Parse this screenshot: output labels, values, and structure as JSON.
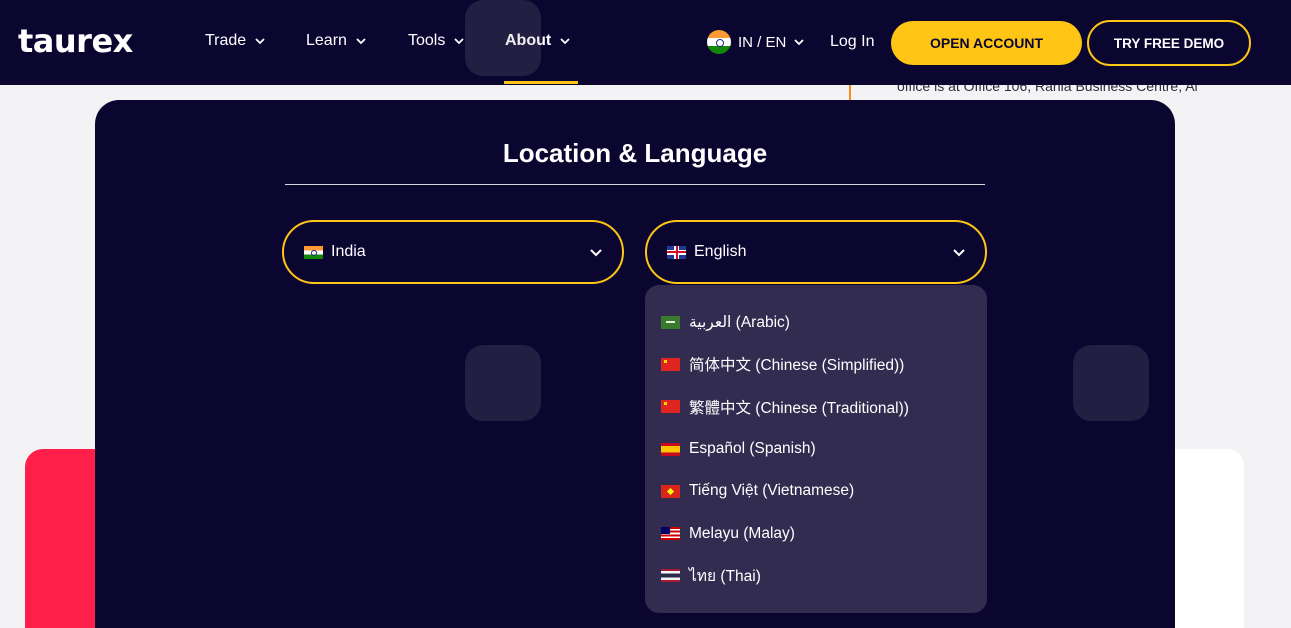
{
  "header": {
    "logo": "taurex",
    "nav": [
      {
        "label": "Trade"
      },
      {
        "label": "Learn"
      },
      {
        "label": "Tools"
      },
      {
        "label": "About"
      }
    ],
    "locale_switch": "IN / EN",
    "login": "Log In",
    "open_account": "OPEN ACCOUNT",
    "try_demo": "TRY FREE DEMO"
  },
  "background": {
    "office_text": "office is at Office 106, Rania Business Centre, Al"
  },
  "modal": {
    "title": "Location & Language",
    "country": {
      "value": "India"
    },
    "language": {
      "value": "English"
    },
    "options": [
      {
        "label": "العربية (Arabic)"
      },
      {
        "label": "简体中文 (Chinese (Simplified))"
      },
      {
        "label": "繁體中文 (Chinese (Traditional))"
      },
      {
        "label": "Español (Spanish)"
      },
      {
        "label": "Tiếng Việt (Vietnamese)"
      },
      {
        "label": "Melayu (Malay)"
      },
      {
        "label": "ไทย (Thai)"
      }
    ]
  },
  "colors": {
    "navy": "#0a0630",
    "accent": "#ffc515",
    "dropdown": "#322c50",
    "red": "#ff1f48"
  },
  "icons": {
    "nav_chevron": "chevron-down-icon",
    "country_flag": "india-flag-icon",
    "language_flag": "uk-flag-icon"
  }
}
